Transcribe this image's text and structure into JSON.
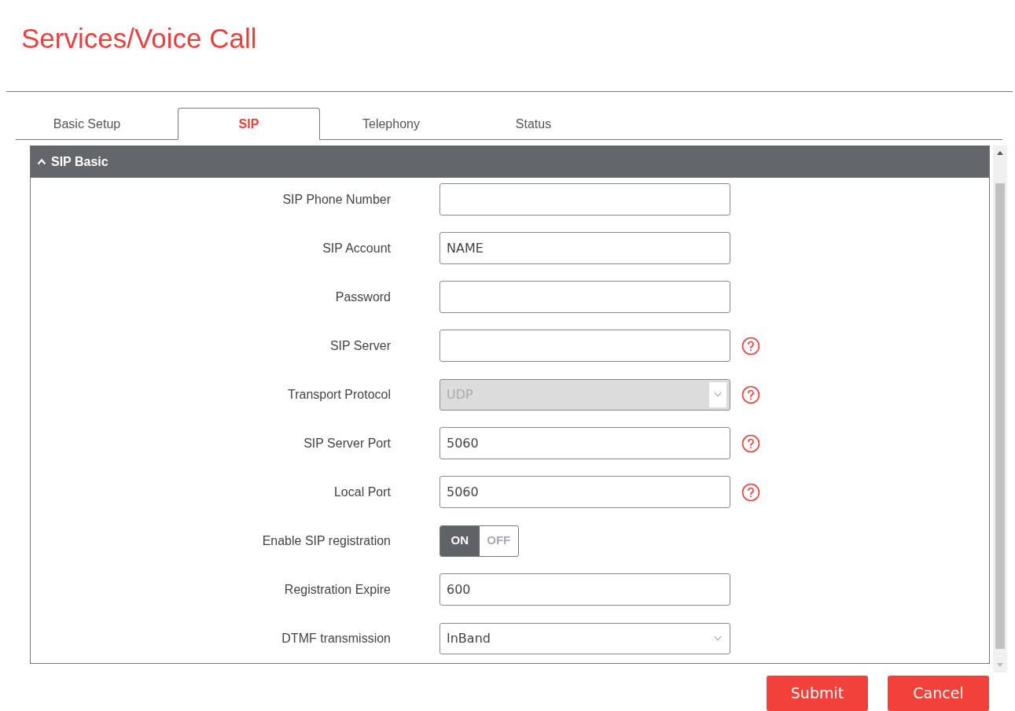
{
  "page_title": "Services/Voice Call",
  "tabs": [
    {
      "label": "Basic Setup",
      "selected": false
    },
    {
      "label": "SIP",
      "selected": true
    },
    {
      "label": "Telephony",
      "selected": false
    },
    {
      "label": "Status",
      "selected": false
    }
  ],
  "section": {
    "title": "SIP Basic",
    "expanded": true,
    "fields": [
      {
        "label": "SIP Phone Number",
        "kind": "text",
        "help": false
      },
      {
        "label": "SIP Account",
        "kind": "text",
        "value": "NAME",
        "help": false
      },
      {
        "label": "Password",
        "kind": "text",
        "help": false
      },
      {
        "label": "SIP Server",
        "kind": "text",
        "help": true
      },
      {
        "label": "Transport Protocol",
        "kind": "select",
        "value": "UDP",
        "disabled": true,
        "help": true
      },
      {
        "label": "SIP Server Port",
        "kind": "text",
        "value": "5060",
        "help": true
      },
      {
        "label": "Local Port",
        "kind": "text",
        "value": "5060",
        "help": true
      },
      {
        "label": "Enable SIP registration",
        "kind": "toggle",
        "on": true,
        "on_label": "ON",
        "off_label": "OFF",
        "help": false
      },
      {
        "label": "Registration Expire",
        "kind": "text",
        "value": "600",
        "help": false
      },
      {
        "label": "DTMF transmission",
        "kind": "select",
        "value": "InBand",
        "disabled": false,
        "help": false
      }
    ]
  },
  "buttons": [
    "Submit",
    "Cancel"
  ]
}
